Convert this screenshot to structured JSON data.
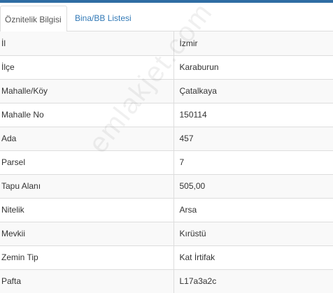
{
  "tabs": [
    {
      "label": "Öznitelik Bilgisi",
      "active": true
    },
    {
      "label": "Bina/BB Listesi",
      "active": false
    }
  ],
  "rows": [
    {
      "label": "İl",
      "value": "İzmir"
    },
    {
      "label": "İlçe",
      "value": "Karaburun"
    },
    {
      "label": "Mahalle/Köy",
      "value": "Çatalkaya"
    },
    {
      "label": "Mahalle No",
      "value": "150114"
    },
    {
      "label": "Ada",
      "value": "457"
    },
    {
      "label": "Parsel",
      "value": "7"
    },
    {
      "label": "Tapu Alanı",
      "value": "505,00"
    },
    {
      "label": "Nitelik",
      "value": "Arsa"
    },
    {
      "label": "Mevkii",
      "value": "Kırüstü"
    },
    {
      "label": "Zemin Tip",
      "value": "Kat İrtifak"
    },
    {
      "label": "Pafta",
      "value": "L17a3a2c"
    }
  ],
  "watermark": "emlakjet.com",
  "colors": {
    "accent": "#2f6da3",
    "link": "#337ab7",
    "stripe": "#f9f9f9",
    "border": "#dddddd"
  }
}
